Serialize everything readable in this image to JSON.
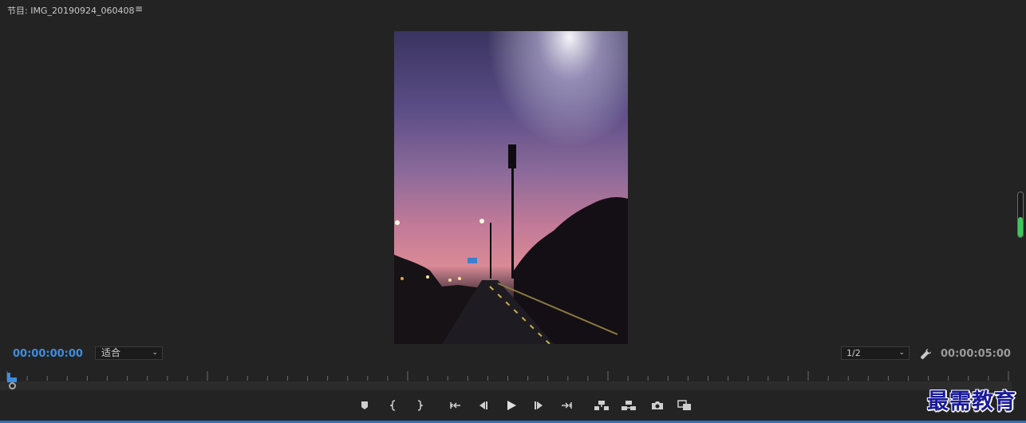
{
  "panel": {
    "title": "节目: IMG_20190924_060408",
    "menu_icon": "≡"
  },
  "playback": {
    "current_timecode": "00:00:00:00",
    "duration_timecode": "00:00:05:00",
    "zoom_value": "适合",
    "resolution_value": "1/2"
  },
  "volume_meter": {
    "level_percent": 45,
    "color": "#3cc95a"
  },
  "transport": {
    "buttons": [
      "add-marker",
      "mark-in",
      "mark-out",
      "go-to-in",
      "step-back",
      "play",
      "step-forward",
      "go-to-out",
      "lift",
      "extract",
      "export-frame",
      "comparison-view"
    ]
  },
  "watermark": {
    "text": "最需教育"
  },
  "colors": {
    "accent": "#3d8ee0",
    "background": "#232323",
    "bottom_border": "#2d6fc1"
  }
}
